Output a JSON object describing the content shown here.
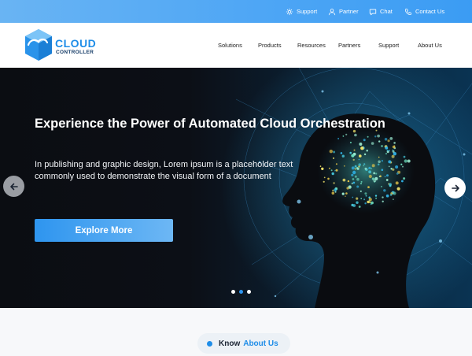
{
  "topbar": {
    "support": "Support",
    "partner": "Partner",
    "chat": "Chat",
    "contact": "Contact Us"
  },
  "logo": {
    "line1": "CLOUD",
    "line2": "CONTROLLER"
  },
  "nav": [
    "Solutions",
    "Products",
    "Resources",
    "Partners",
    "Support",
    "About Us"
  ],
  "hero": {
    "title": "Experience the Power of Automated Cloud Orchestration",
    "description": "In publishing and graphic design, Lorem ipsum is a placeholder text commonly used to demonstrate the visual form of a document",
    "cta": "Explore More",
    "slides_total": 3,
    "active_slide": 2
  },
  "section": {
    "badge_part1": "Know",
    "badge_part2": "About Us"
  },
  "colors": {
    "brand": "#1e8de8",
    "dark": "#133a66",
    "hero_bg": "#0b0d12"
  },
  "icons": [
    "gear-icon",
    "user-icon",
    "chat-icon",
    "phone-icon",
    "arrow-left-icon",
    "arrow-right-icon"
  ]
}
